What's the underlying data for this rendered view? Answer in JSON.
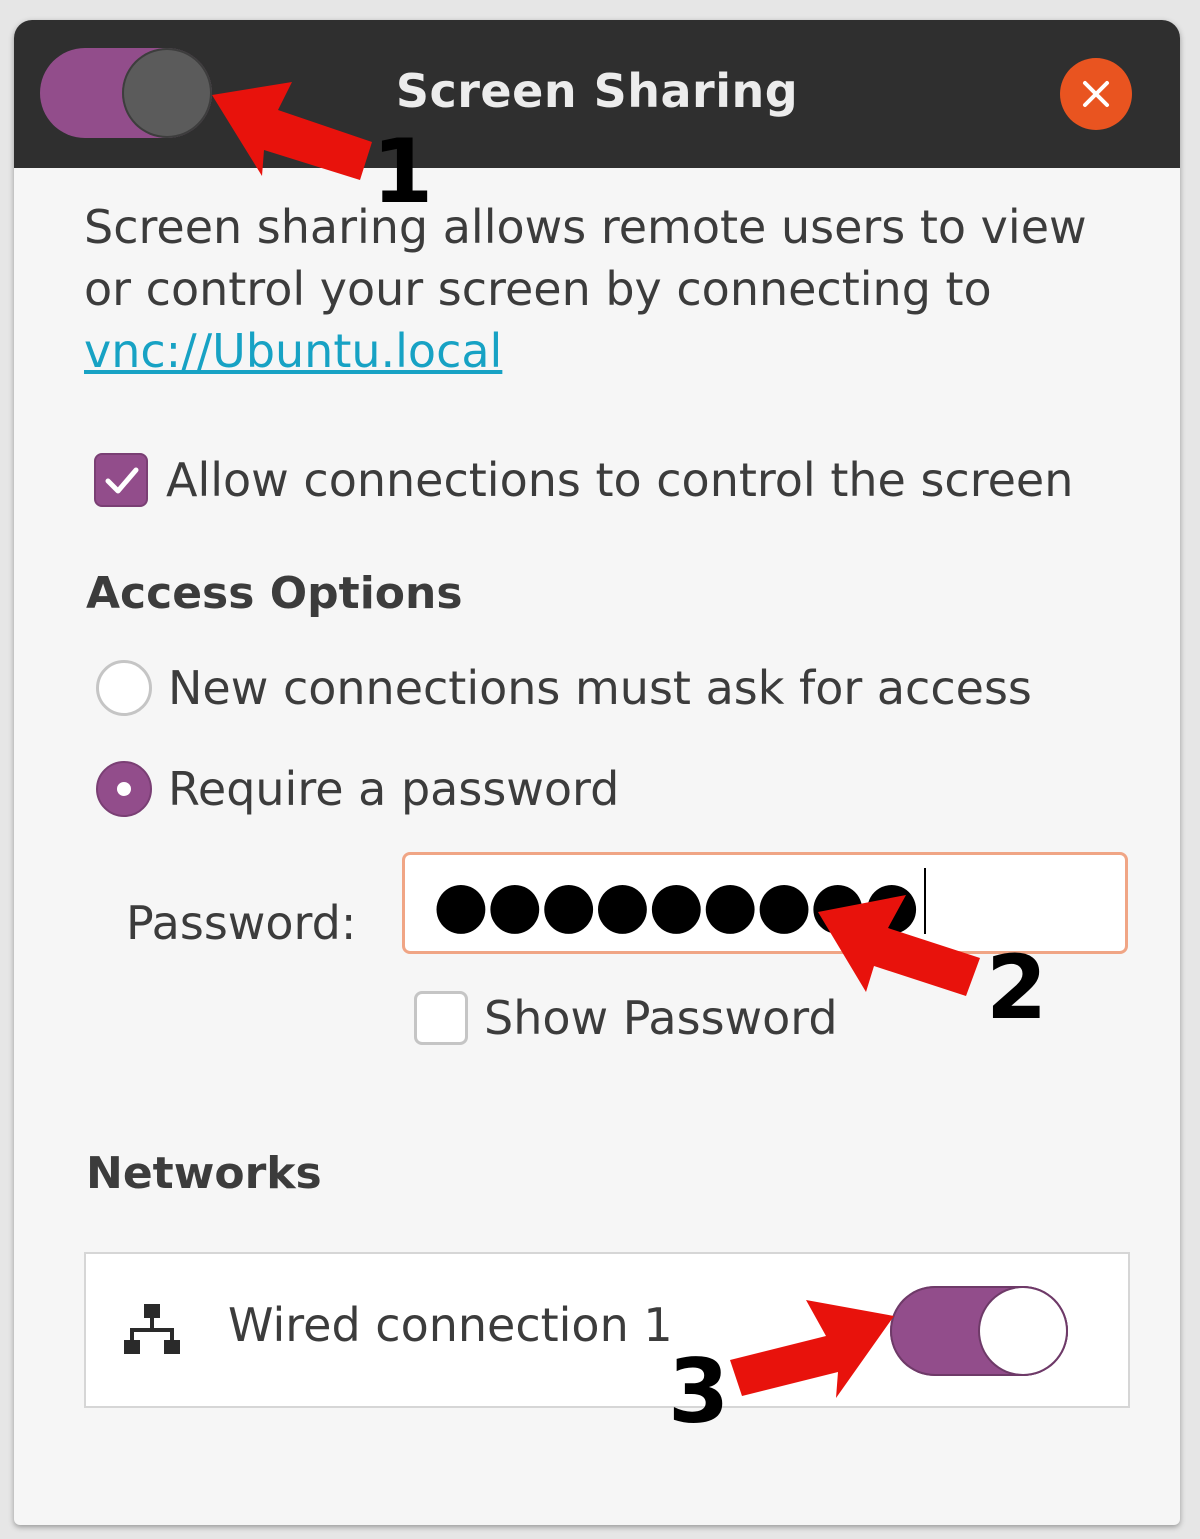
{
  "window": {
    "title": "Screen Sharing",
    "master_toggle_on": true,
    "close_icon": "close-icon"
  },
  "description": {
    "text": "Screen sharing allows remote users to view or control your screen by connecting to",
    "link": "vnc://Ubuntu.local"
  },
  "allow_control": {
    "label": "Allow connections to control the screen",
    "checked": true
  },
  "access_options": {
    "heading": "Access Options",
    "options": [
      {
        "label": "New connections must ask for access",
        "selected": false
      },
      {
        "label": "Require a password",
        "selected": true
      }
    ],
    "password_label": "Password:",
    "password_value": "●●●●●●●●●",
    "show_password": {
      "label": "Show Password",
      "checked": false
    }
  },
  "networks": {
    "heading": "Networks",
    "items": [
      {
        "label": "Wired connection 1",
        "icon": "network-wired-icon",
        "enabled": true
      }
    ]
  },
  "annotations": {
    "labels": [
      "1",
      "2",
      "3"
    ],
    "arrow_color": "#e8120c"
  },
  "colors": {
    "accent": "#924d8b",
    "titlebar": "#2f2f2f",
    "close": "#e95420",
    "link": "#17a2c4",
    "focus_border": "#f0a585"
  }
}
